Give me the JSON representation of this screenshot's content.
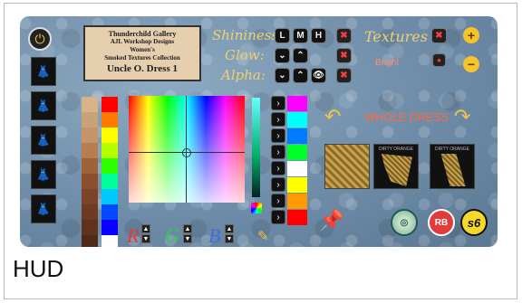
{
  "hud": {
    "banner": {
      "line1": "Thunderchild Gallery",
      "line2": "AJL Workshop Designs",
      "line3": "Women's",
      "line4": "Smoked Textures Collection",
      "title": "Uncle O. Dress 1"
    },
    "labels": {
      "shininess": "Shininess:",
      "glow": "Glow:",
      "alpha": "Alpha:",
      "textures": "Textures",
      "bright": "Bright",
      "whole_dress": "WHOLE DRESS"
    },
    "shininess_buttons": [
      "L",
      "M",
      "H"
    ],
    "rgb": {
      "r": "R",
      "g": "G",
      "b": "B"
    },
    "logos": {
      "rb": "RB",
      "s6": "s6"
    },
    "texture_captions": [
      "",
      "DIRTY ORANGE",
      "DIRTY ORANGE"
    ],
    "colors": {
      "swatches_left": [
        "#d7b389",
        "#caa27a",
        "#c59469",
        "#b77c4f",
        "#9d6238",
        "#8b4f2e",
        "#7b4428",
        "#6d3a22",
        "#5e321f",
        "#4f2a1a"
      ],
      "swatches_right": [
        "#ff0000",
        "#ff7a00",
        "#ffff00",
        "#b5ff00",
        "#2cff00",
        "#00ff9a",
        "#00c8ff",
        "#0049ff",
        "#0a00ff",
        "#ffffff"
      ],
      "column_right": [
        "#ff00ff",
        "#00ffff",
        "#007bff",
        "#00ff2a",
        "#ffffff",
        "#ffff00",
        "#ff9a00",
        "#ff0000"
      ]
    },
    "caption": "HUD"
  }
}
